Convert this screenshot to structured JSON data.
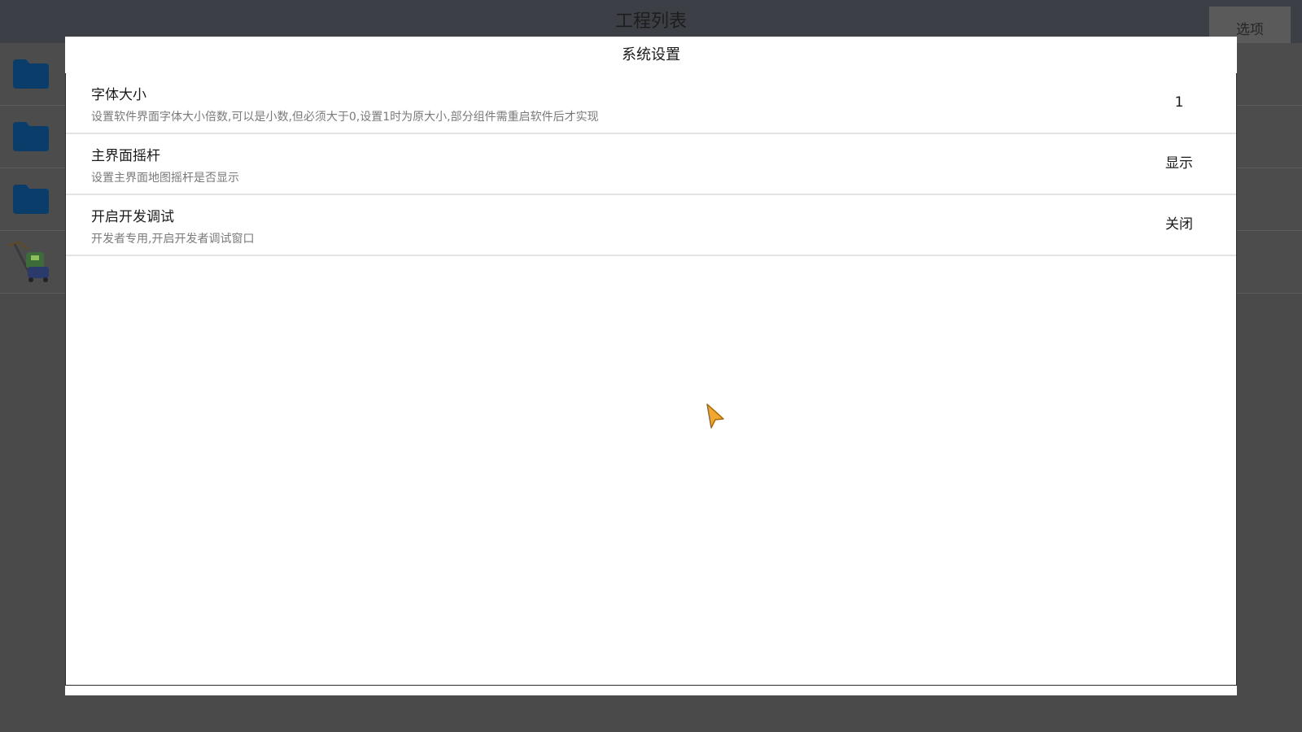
{
  "app": {
    "title": "工程列表",
    "options_label": "选项",
    "projects": [
      {
        "icon": "folder-icon",
        "name": "",
        "color": "#0b3d6b"
      },
      {
        "icon": "folder-icon",
        "name": "",
        "color": "#0b3d6b"
      },
      {
        "icon": "folder-icon",
        "name": "",
        "color": "#0b3d6b"
      },
      {
        "icon": "game-character-icon",
        "name": ""
      }
    ]
  },
  "dialog": {
    "title": "系统设置",
    "settings": [
      {
        "title": "字体大小",
        "description": "设置软件界面字体大小倍数,可以是小数,但必须大于0,设置1时为原大小,部分组件需重启软件后才实现",
        "value": "1"
      },
      {
        "title": "主界面摇杆",
        "description": "设置主界面地图摇杆是否显示",
        "value": "显示"
      },
      {
        "title": "开启开发调试",
        "description": "开发者专用,开启开发者调试窗口",
        "value": "关闭"
      }
    ]
  },
  "cursor": {
    "icon": "mouse-pointer-icon",
    "color": "#f0a830"
  }
}
